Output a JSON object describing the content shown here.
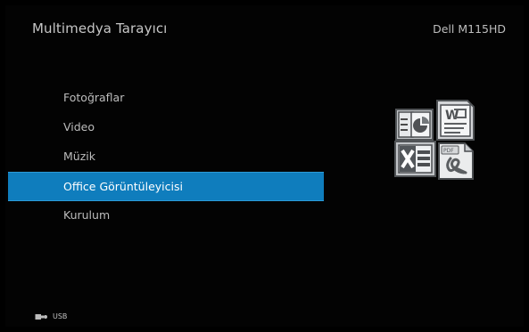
{
  "header": {
    "title": "Multimedya Tarayıcı",
    "device": "Dell M115HD"
  },
  "menu": {
    "items": [
      {
        "label": "Fotoğraflar",
        "selected": false
      },
      {
        "label": "Video",
        "selected": false
      },
      {
        "label": "Müzik",
        "selected": false
      },
      {
        "label": "Office Görüntüleyicisi",
        "selected": true
      },
      {
        "label": "Kurulum",
        "selected": false
      }
    ]
  },
  "icons": {
    "group": "office-document-icons",
    "items": [
      "presentation-icon",
      "word-document-icon",
      "excel-spreadsheet-icon",
      "pdf-document-icon"
    ]
  },
  "status": {
    "source": "USB"
  },
  "colors": {
    "background": "#000000",
    "selected": "#0f7dbd",
    "text": "#cfcfcf"
  }
}
